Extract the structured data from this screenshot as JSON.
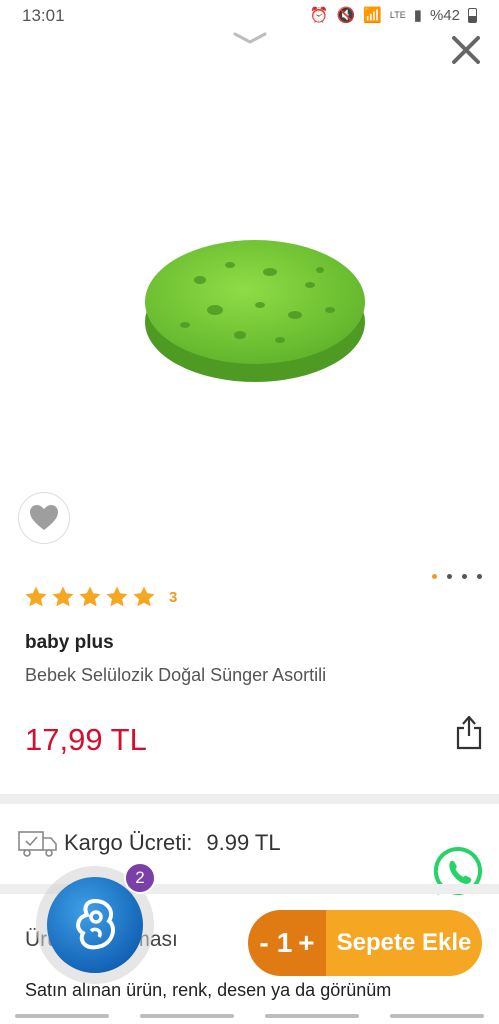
{
  "status_bar": {
    "time": "13:01",
    "battery": "%42",
    "network": "LTE"
  },
  "product": {
    "brand": "baby plus",
    "title": "Bebek Selülozik Doğal Sünger Asortili",
    "price": "17,99 TL",
    "rating_count": "3",
    "rating_stars": 5,
    "image_color": "#7ccf3a"
  },
  "gallery": {
    "dot_count": 4,
    "active_index": 0
  },
  "cargo": {
    "label": "Kargo Ücreti:",
    "value": "9.99 TL"
  },
  "description": {
    "heading": "Ürün Açıklaması",
    "text": "Satın alınan ürün, renk, desen ya da görünüm"
  },
  "floating_button": {
    "badge_count": "2"
  },
  "cart": {
    "minus": "-",
    "quantity": "1",
    "plus": "+",
    "add_label": "Sepete Ekle"
  },
  "colors": {
    "accent": "#f5a623",
    "accent_dark": "#e07a12",
    "price": "#d5102f",
    "badge": "#7b3fa8",
    "whatsapp": "#25d366"
  }
}
